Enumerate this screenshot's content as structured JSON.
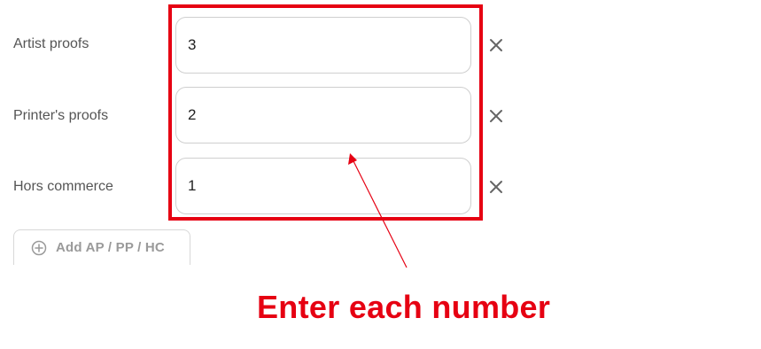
{
  "rows": [
    {
      "label": "Artist proofs",
      "value": "3"
    },
    {
      "label": "Printer's proofs",
      "value": "2"
    },
    {
      "label": "Hors commerce",
      "value": "1"
    }
  ],
  "add_button": {
    "label": "Add AP / PP / HC"
  },
  "annotation": {
    "text": "Enter each number",
    "color": "#e60012"
  },
  "icons": {
    "remove": "close-icon",
    "add": "plus-circle-icon"
  }
}
